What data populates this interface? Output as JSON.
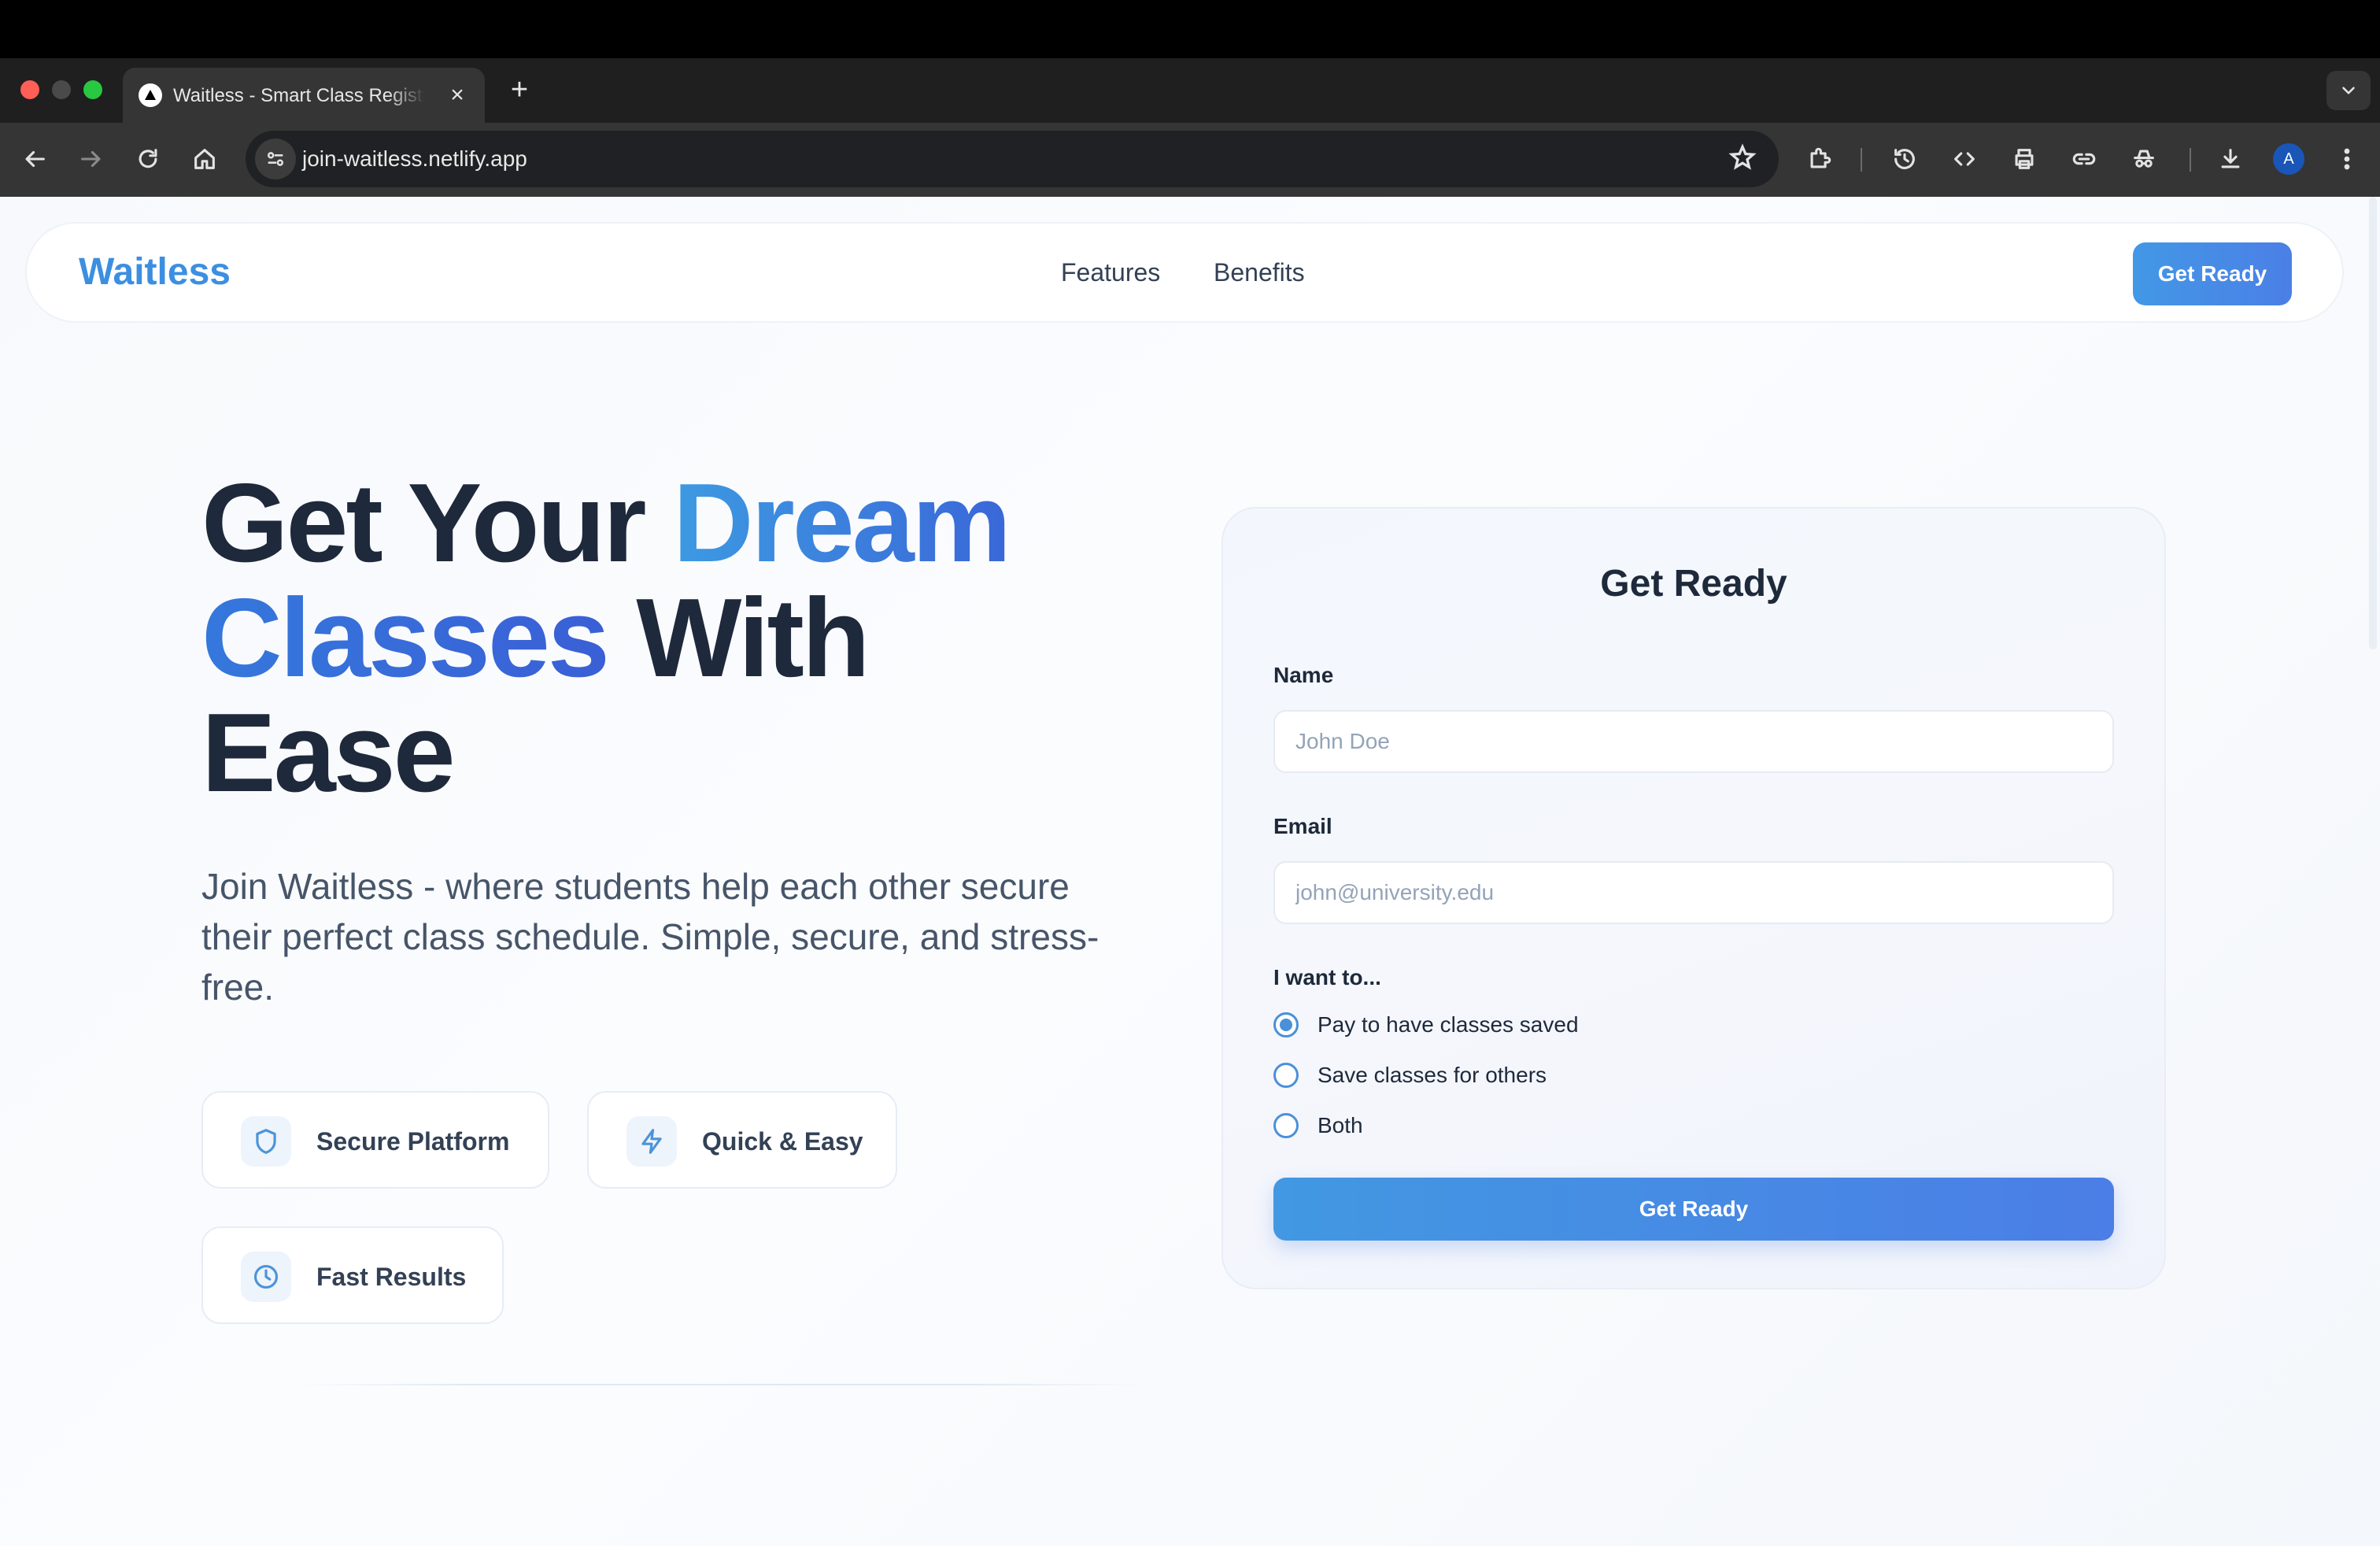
{
  "browser": {
    "tab_title": "Waitless - Smart Class Registration",
    "url": "join-waitless.netlify.app",
    "profile_initial": "A",
    "icons": [
      "back-icon",
      "forward-icon",
      "reload-icon",
      "home-icon",
      "site-info-icon",
      "bookmark-star-icon",
      "extensions-icon",
      "history-icon",
      "code-icon",
      "print-icon",
      "link-icon",
      "incognito-icon",
      "download-icon",
      "more-icon"
    ]
  },
  "nav": {
    "brand": "Waitless",
    "links": [
      "Features",
      "Benefits"
    ],
    "cta": "Get Ready"
  },
  "hero": {
    "title_part1": "Get Your ",
    "title_accent1": "Dream",
    "title_accent2": "Classes",
    "title_part2": " With Ease",
    "subtitle": "Join Waitless - where students help each other secure their perfect class schedule. Simple, secure, and stress-free.",
    "features": [
      {
        "icon": "shield-icon",
        "label": "Secure Platform"
      },
      {
        "icon": "lightning-icon",
        "label": "Quick & Easy"
      },
      {
        "icon": "clock-icon",
        "label": "Fast Results"
      }
    ]
  },
  "form": {
    "title": "Get Ready",
    "name_label": "Name",
    "name_placeholder": "John Doe",
    "email_label": "Email",
    "email_placeholder": "john@university.edu",
    "intent_label": "I want to...",
    "options": [
      "Pay to have classes saved",
      "Save classes for others",
      "Both"
    ],
    "selected_option": "Pay to have classes saved",
    "submit": "Get Ready"
  },
  "colors": {
    "brand": "#3c8fe0",
    "accent_gradient_start": "#4298e6",
    "accent_gradient_end": "#4b7fe6",
    "heading": "#1e293b"
  }
}
